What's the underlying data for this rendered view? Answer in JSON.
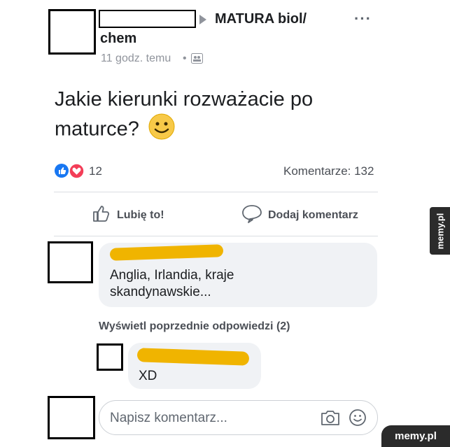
{
  "post": {
    "group_name_line1": "MATURA biol/",
    "group_name_line2": "chem",
    "time": "11 godz. temu",
    "text": "Jakie kierunki rozważacie po maturce?",
    "reaction_count": "12",
    "comments_count": "Komentarze: 132"
  },
  "actions": {
    "like_label": "Lubię to!",
    "comment_label": "Dodaj komentarz"
  },
  "comments": [
    {
      "text": "Anglia, Irlandia, kraje skandynawskie..."
    }
  ],
  "view_previous": "Wyświetl poprzednie odpowiedzi (2)",
  "reply": {
    "text": "XD"
  },
  "composer": {
    "placeholder": "Napisz komentarz..."
  },
  "watermarks": {
    "side": "memy.pl",
    "bottom": "memy.pl"
  },
  "colors": {
    "like_blue": "#1877f2",
    "love_red": "#f33e58",
    "emoji_yellow": "#f7c948"
  }
}
